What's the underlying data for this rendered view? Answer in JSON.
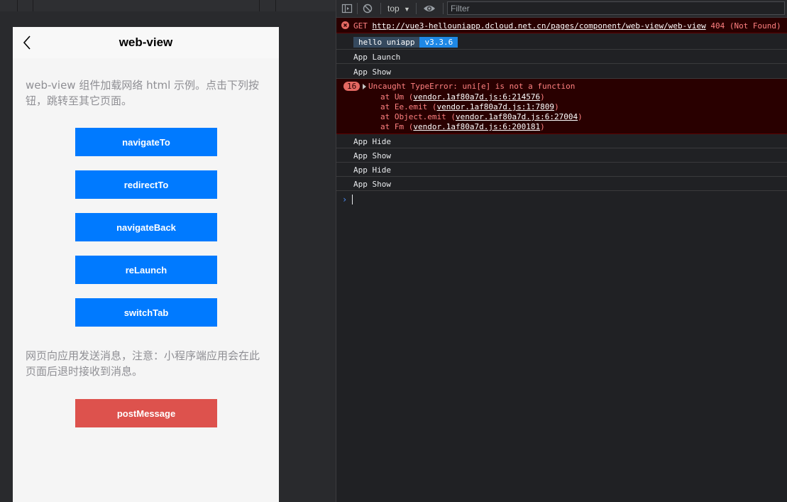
{
  "app": {
    "nav_title": "web-view",
    "intro_text": "web-view 组件加载网络 html 示例。点击下列按钮，跳转至其它页面。",
    "buttons": [
      "navigateTo",
      "redirectTo",
      "navigateBack",
      "reLaunch",
      "switchTab"
    ],
    "post_note": "网页向应用发送消息，注意：小程序端应用会在此页面后退时接收到消息。",
    "post_button": "postMessage",
    "colors": {
      "primary": "#007aff",
      "danger": "#dd524d",
      "page_bg": "#f5f5f5"
    }
  },
  "devtools": {
    "context": "top",
    "filter_placeholder": "Filter",
    "get_error": {
      "method": "GET",
      "url": "http://vue3-hellouniapp.dcloud.net.cn/pages/component/web-view/web-view",
      "status": "404 (Not Found)"
    },
    "version_badge": {
      "name": "hello uniapp",
      "version": "v3.3.6"
    },
    "logs_before": [
      "App Launch",
      "App Show"
    ],
    "type_error": {
      "count": "16",
      "message": "Uncaught TypeError: uni[e] is not a function",
      "stack": [
        {
          "prefix": "at Um (",
          "link": "vendor.1af80a7d.js:6:214576",
          "suffix": ")"
        },
        {
          "prefix": "at Ee.emit (",
          "link": "vendor.1af80a7d.js:1:7809",
          "suffix": ")"
        },
        {
          "prefix": "at Object.emit (",
          "link": "vendor.1af80a7d.js:6:27004",
          "suffix": ")"
        },
        {
          "prefix": "at Fm (",
          "link": "vendor.1af80a7d.js:6:200181",
          "suffix": ")"
        }
      ]
    },
    "logs_after": [
      "App Hide",
      "App Show",
      "App Hide",
      "App Show"
    ],
    "prompt_glyph": "›"
  }
}
